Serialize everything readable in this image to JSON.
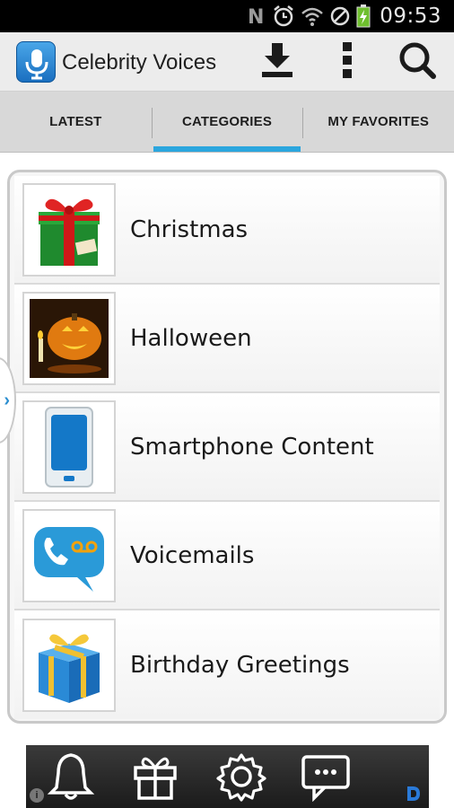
{
  "status_bar": {
    "time": "09:53",
    "icons": [
      "nfc-icon",
      "alarm-icon",
      "wifi-icon",
      "no-signal-icon",
      "battery-charging-icon"
    ]
  },
  "action_bar": {
    "app_icon": "microphone-icon",
    "title": "Celebrity Voices",
    "actions": [
      "download-icon",
      "overflow-menu-icon",
      "search-icon"
    ]
  },
  "tabs": [
    {
      "label": "LATEST",
      "active": false
    },
    {
      "label": "CATEGORIES",
      "active": true
    },
    {
      "label": "MY FAVORITES",
      "active": false
    }
  ],
  "categories": [
    {
      "label": "Christmas",
      "icon": "christmas-gift-icon"
    },
    {
      "label": "Halloween",
      "icon": "pumpkin-icon"
    },
    {
      "label": "Smartphone Content",
      "icon": "smartphone-icon"
    },
    {
      "label": "Voicemails",
      "icon": "voicemail-icon"
    },
    {
      "label": "Birthday Greetings",
      "icon": "birthday-gift-icon"
    }
  ],
  "side_handle": {
    "glyph": "›"
  },
  "ad_bar": {
    "icons": [
      "bell-icon",
      "gift-icon",
      "settings-gear-icon",
      "chat-bubble-icon"
    ],
    "info_glyph": "i"
  },
  "colors": {
    "accent": "#2ba6de",
    "tab_background": "#d8d8d8",
    "action_bar_background": "#ececec",
    "status_bar": "#000000"
  }
}
